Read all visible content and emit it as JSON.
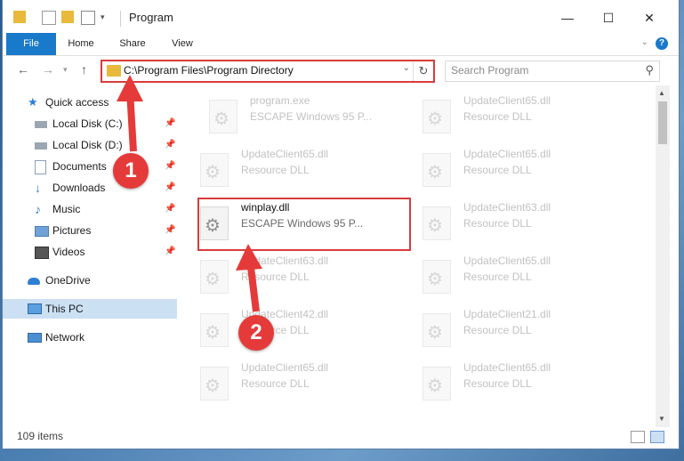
{
  "window": {
    "title": "Program"
  },
  "ribbon": {
    "tabs": [
      "File",
      "Home",
      "Share",
      "View"
    ],
    "help": "?"
  },
  "address": {
    "path": "C:\\Program Files\\Program Directory"
  },
  "search": {
    "placeholder": "Search Program"
  },
  "nav": {
    "items": [
      {
        "label": "Quick access",
        "icon": "star-icon"
      },
      {
        "label": "Local Disk (C:)",
        "icon": "drive-icon",
        "pinned": true
      },
      {
        "label": "Local Disk (D:)",
        "icon": "drive-icon",
        "pinned": true
      },
      {
        "label": "Documents",
        "icon": "documents-icon",
        "pinned": true
      },
      {
        "label": "Downloads",
        "icon": "download-icon",
        "pinned": true
      },
      {
        "label": "Music",
        "icon": "music-icon",
        "pinned": true
      },
      {
        "label": "Pictures",
        "icon": "pictures-icon",
        "pinned": true
      },
      {
        "label": "Videos",
        "icon": "videos-icon",
        "pinned": true
      },
      {
        "label": "OneDrive",
        "icon": "onedrive-icon"
      },
      {
        "label": "This PC",
        "icon": "computer-icon",
        "selected": true
      },
      {
        "label": "Network",
        "icon": "network-icon"
      }
    ]
  },
  "files": [
    {
      "name": "program.exe",
      "desc": "ESCAPE Windows 95 P...",
      "faded": true
    },
    {
      "name": "UpdateClient65.dll",
      "desc": "Resource DLL",
      "faded": true
    },
    {
      "name": "UpdateClient65.dll",
      "desc": "Resource DLL",
      "faded": true
    },
    {
      "name": "UpdateClient65.dll",
      "desc": "Resource DLL",
      "faded": true
    },
    {
      "name": "winplay.dll",
      "desc": "ESCAPE Windows 95 P...",
      "faded": false
    },
    {
      "name": "UpdateClient63.dll",
      "desc": "Resource DLL",
      "faded": true
    },
    {
      "name": "UpdateClient63.dll",
      "desc": "Resource DLL",
      "faded": true
    },
    {
      "name": "UpdateClient65.dll",
      "desc": "Resource DLL",
      "faded": true
    },
    {
      "name": "UpdateClient42.dll",
      "desc": "Resource DLL",
      "faded": true
    },
    {
      "name": "UpdateClient21.dll",
      "desc": "Resource DLL",
      "faded": true
    },
    {
      "name": "UpdateClient65.dll",
      "desc": "Resource DLL",
      "faded": true
    },
    {
      "name": "UpdateClient65.dll",
      "desc": "Resource DLL",
      "faded": true
    }
  ],
  "status": {
    "count": "109 items"
  },
  "annotations": {
    "step1": "1",
    "step2": "2"
  },
  "colors": {
    "accent": "#1979ca",
    "highlight": "#d93b3b",
    "badge": "#e53a3a",
    "folder": "#e8b93a"
  }
}
